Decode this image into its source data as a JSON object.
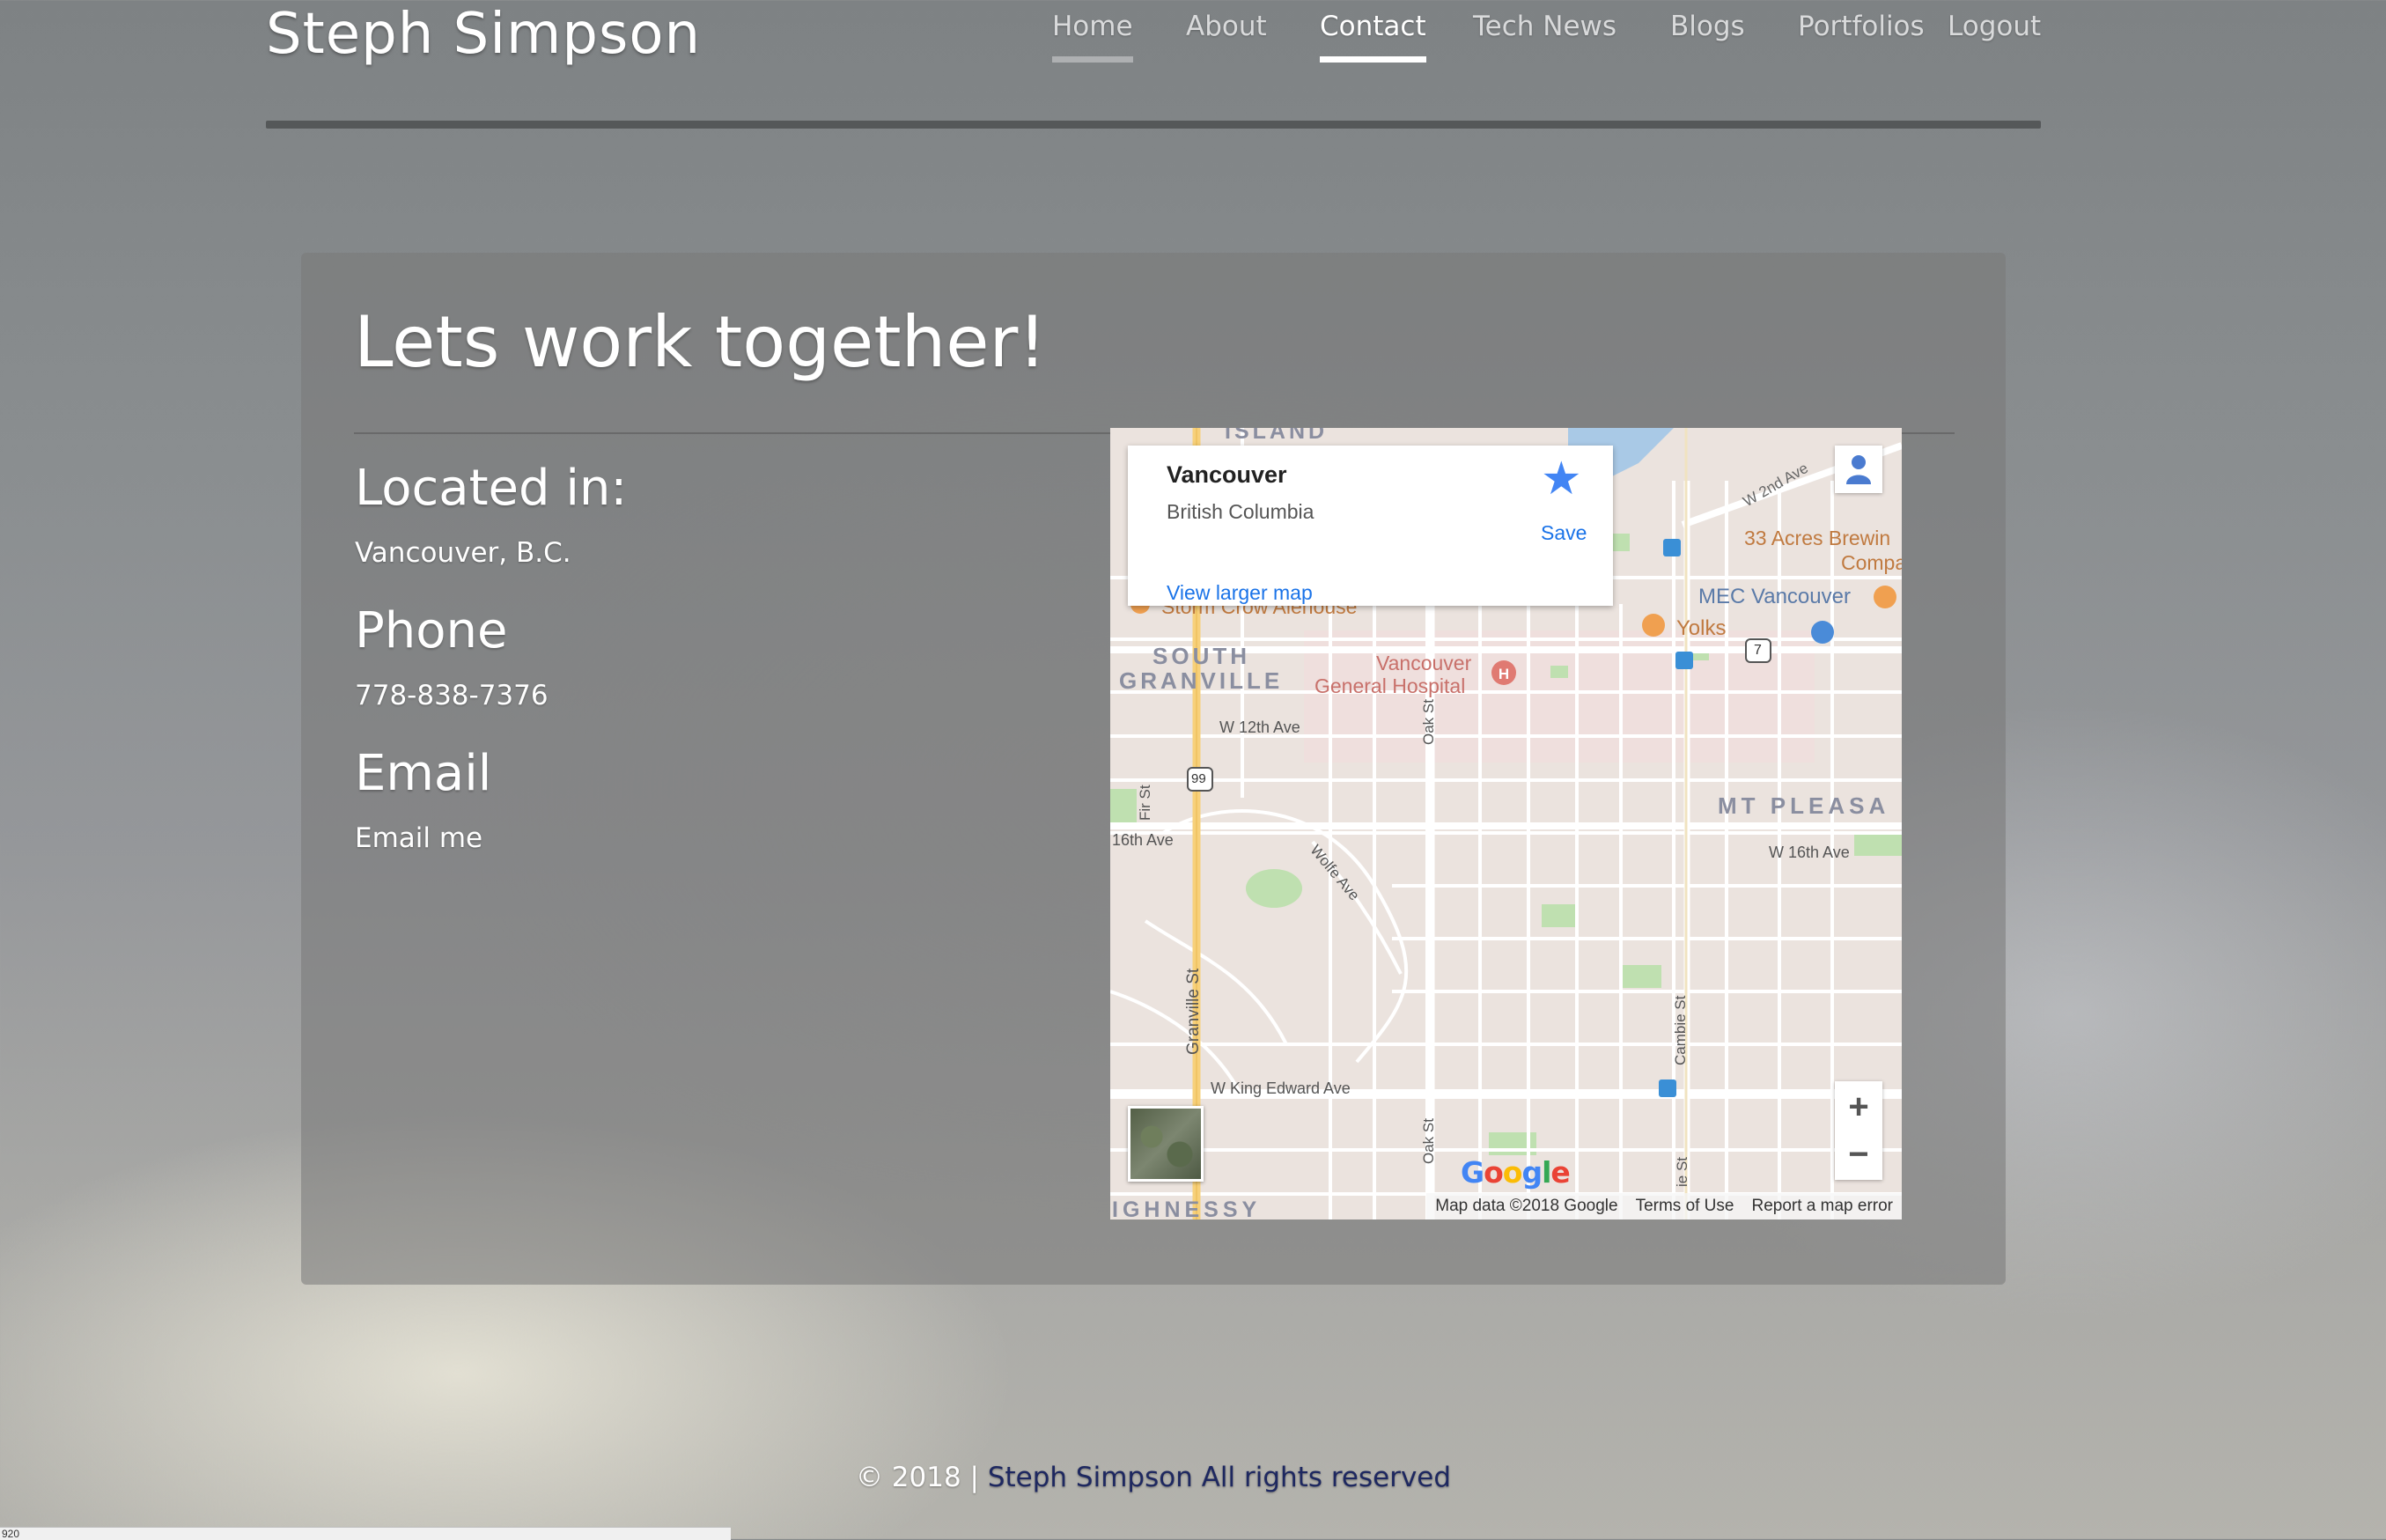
{
  "site": {
    "title": "Steph Simpson"
  },
  "nav": {
    "items": [
      {
        "label": "Home"
      },
      {
        "label": "About"
      },
      {
        "label": "Contact"
      },
      {
        "label": "Tech News"
      },
      {
        "label": "Blogs"
      },
      {
        "label": "Portfolios"
      },
      {
        "label": "Logout"
      }
    ],
    "active": "Contact"
  },
  "contact": {
    "heading": "Lets work together!",
    "location_label": "Located in:",
    "location_value": "Vancouver, B.C.",
    "phone_label": "Phone",
    "phone_value": "778-838-7376",
    "email_label": "Email",
    "email_link": "Email me"
  },
  "map": {
    "place_name": "Vancouver",
    "place_region": "British Columbia",
    "save_label": "Save",
    "larger_map_label": "View larger map",
    "zoom_in": "+",
    "zoom_out": "−",
    "logo": "Google",
    "attribution": {
      "map_data": "Map data ©2018 Google",
      "terms": "Terms of Use",
      "report": "Report a map error"
    },
    "labels": {
      "island": "ISLAND",
      "w2nd": "W 2nd Ave",
      "acres": "33 Acres Brewin",
      "acres2": "Compa",
      "mec": "MEC Vancouver",
      "yolks": "Yolks",
      "stormcrow": "Storm Crow Alehouse",
      "south": "SOUTH",
      "granville_area": "GRANVILLE",
      "hospital1": "Vancouver",
      "hospital2": "General Hospital",
      "w12th": "W 12th Ave",
      "oak": "Oak St",
      "fir": "Fir St",
      "hwy99": "99",
      "hwy7": "7",
      "w16th_left": "16th Ave",
      "w16th_right": "W 16th Ave",
      "wolfe": "Wolfe Ave",
      "mtpleasant": "MT PLEASA",
      "granville_st": "Granville St",
      "cambie": "Cambie St",
      "king_edward": "W King Edward Ave",
      "oak_lower": "Oak St",
      "cambie_lower": "ie St",
      "shaughnessy": "IGHNESSY"
    },
    "colors": {
      "land": "#ebe3de",
      "road": "#ffffff",
      "highway": "#f7d07a",
      "park": "#bfe0b0",
      "water": "#a9c9e6",
      "transit": "#3a8fd6"
    }
  },
  "footer": {
    "copyright": "© 2018 | ",
    "brand": "Steph Simpson",
    "rights": " All rights reserved"
  },
  "statusbar": {
    "text": "920"
  }
}
